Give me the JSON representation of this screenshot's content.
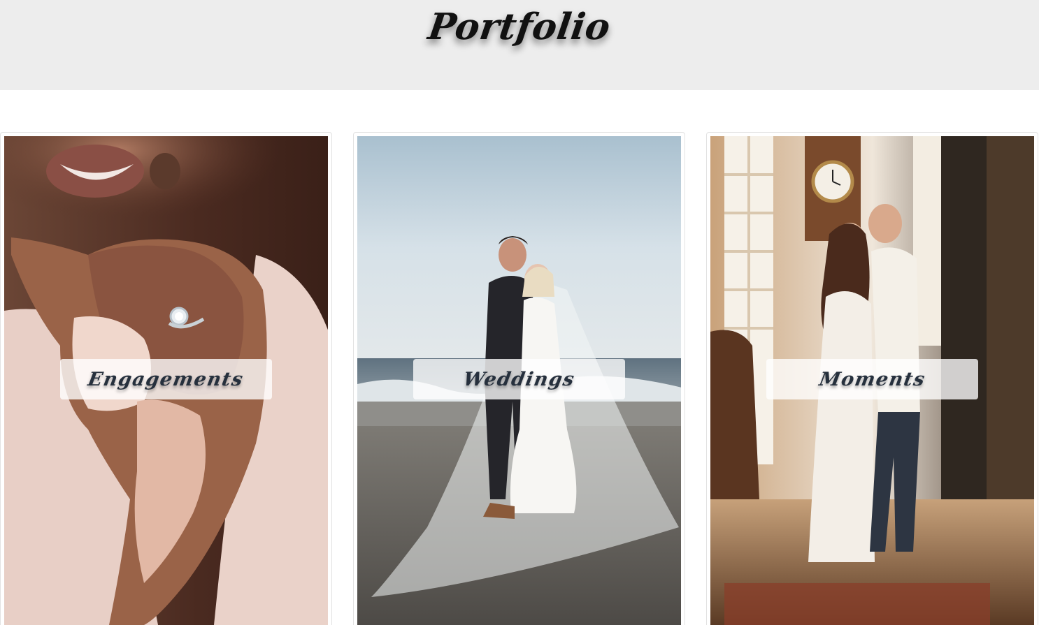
{
  "header": {
    "title": "Portfolio"
  },
  "cards": [
    {
      "label": "Engagements"
    },
    {
      "label": "Weddings"
    },
    {
      "label": "Moments"
    }
  ],
  "colors": {
    "header_bg": "#ededed",
    "label_text": "#26303d",
    "label_bg": "rgba(255,255,255,0.78)"
  }
}
